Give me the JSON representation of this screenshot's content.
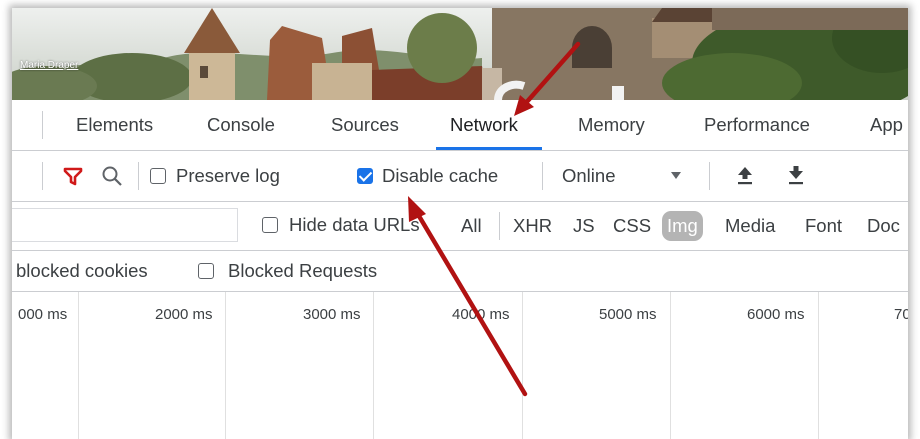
{
  "banner": {
    "credit": "Maria Draper"
  },
  "devtools": {
    "tabs": [
      {
        "label": "Elements"
      },
      {
        "label": "Console"
      },
      {
        "label": "Sources"
      },
      {
        "label": "Network",
        "active": true
      },
      {
        "label": "Memory"
      },
      {
        "label": "Performance"
      },
      {
        "label": "App"
      }
    ],
    "accent_color": "#1a73e8"
  },
  "toolbar": {
    "preserve_log": {
      "label": "Preserve log",
      "checked": false
    },
    "disable_cache": {
      "label": "Disable cache",
      "checked": true
    },
    "throttling": {
      "value": "Online"
    },
    "icons": [
      "filter-icon",
      "search-icon",
      "dropdown-arrow-icon",
      "import-icon",
      "export-icon"
    ],
    "filter_icon_color": "#d01919"
  },
  "filters": {
    "hide_data_urls": {
      "label": "Hide data URLs",
      "checked": false
    },
    "types": [
      {
        "label": "All"
      },
      {
        "label": "XHR"
      },
      {
        "label": "JS"
      },
      {
        "label": "CSS"
      },
      {
        "label": "Img",
        "active": true
      },
      {
        "label": "Media"
      },
      {
        "label": "Font"
      },
      {
        "label": "Doc"
      }
    ]
  },
  "blocked": {
    "blocked_cookies": {
      "label": "blocked cookies"
    },
    "blocked_requests": {
      "label": "Blocked Requests",
      "checked": false
    }
  },
  "timeline": {
    "ticks": [
      "000 ms",
      "2000 ms",
      "3000 ms",
      "4000 ms",
      "5000 ms",
      "6000 ms",
      "70"
    ]
  },
  "annotation": {
    "arrow_color": "#b11212"
  }
}
